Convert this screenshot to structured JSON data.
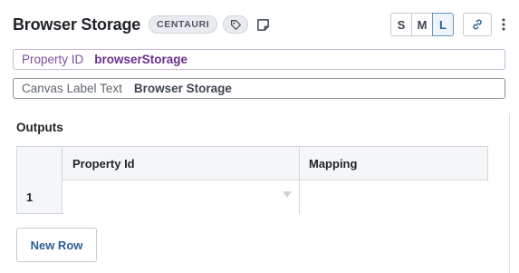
{
  "header": {
    "title": "Browser Storage",
    "badge": "CENTAURI",
    "sizes": [
      "S",
      "M",
      "L"
    ],
    "active_size": "L"
  },
  "fields": {
    "property_id": {
      "label": "Property ID",
      "value": "browserStorage"
    },
    "canvas_label": {
      "label": "Canvas Label Text",
      "value": "Browser Storage"
    }
  },
  "outputs": {
    "section_label": "Outputs",
    "columns": [
      "Property Id",
      "Mapping"
    ],
    "rows": [
      {
        "number": "1",
        "property_id": "",
        "mapping": ""
      }
    ],
    "new_row_label": "New Row"
  },
  "colors": {
    "accent": "#2a5f93",
    "property_purple": "#6a2f8c"
  }
}
